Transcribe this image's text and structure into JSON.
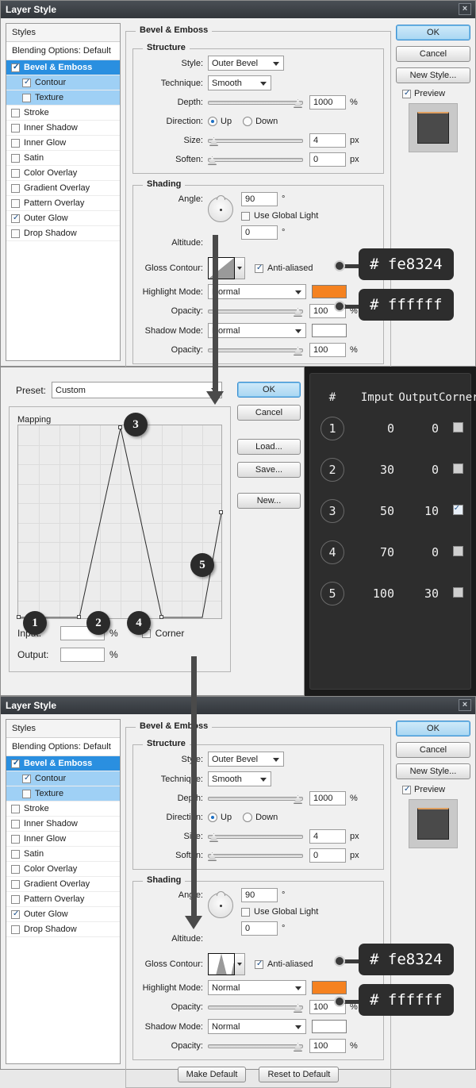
{
  "dialog": {
    "title": "Layer Style",
    "close_label": "×",
    "sidebar": {
      "header": "Styles",
      "blending": "Blending Options: Default",
      "items": [
        {
          "label": "Bevel & Emboss",
          "checked": true,
          "selected": true
        },
        {
          "label": "Contour",
          "checked": true,
          "child": true
        },
        {
          "label": "Texture",
          "checked": false,
          "child": true
        },
        {
          "label": "Stroke",
          "checked": false
        },
        {
          "label": "Inner Shadow",
          "checked": false
        },
        {
          "label": "Inner Glow",
          "checked": false
        },
        {
          "label": "Satin",
          "checked": false
        },
        {
          "label": "Color Overlay",
          "checked": false
        },
        {
          "label": "Gradient Overlay",
          "checked": false
        },
        {
          "label": "Pattern Overlay",
          "checked": false
        },
        {
          "label": "Outer Glow",
          "checked": true
        },
        {
          "label": "Drop Shadow",
          "checked": false
        }
      ]
    },
    "group_title": "Bevel & Emboss",
    "structure": {
      "title": "Structure",
      "style_label": "Style:",
      "style_value": "Outer Bevel",
      "technique_label": "Technique:",
      "technique_value": "Smooth",
      "depth_label": "Depth:",
      "depth_value": "1000",
      "depth_unit": "%",
      "direction_label": "Direction:",
      "direction_up": "Up",
      "direction_down": "Down",
      "size_label": "Size:",
      "size_value": "4",
      "size_unit": "px",
      "soften_label": "Soften:",
      "soften_value": "0",
      "soften_unit": "px"
    },
    "shading": {
      "title": "Shading",
      "angle_label": "Angle:",
      "angle_value": "90",
      "degree": "°",
      "global_light_label": "Use Global Light",
      "altitude_label": "Altitude:",
      "altitude_value": "0",
      "gloss_label": "Gloss Contour:",
      "antialiased_label": "Anti-aliased",
      "highlight_label": "Highlight Mode:",
      "highlight_mode": "Normal",
      "highlight_opacity_label": "Opacity:",
      "highlight_opacity": "100",
      "shadow_label": "Shadow Mode:",
      "shadow_mode": "Normal",
      "shadow_opacity_label": "Opacity:",
      "shadow_opacity": "100",
      "percent": "%"
    },
    "make_default": "Make Default",
    "reset_default": "Reset to Default",
    "right": {
      "ok": "OK",
      "cancel": "Cancel",
      "new_style": "New Style...",
      "preview": "Preview"
    },
    "hex_highlight": "# fe8324",
    "hex_shadow": "# ffffff",
    "swatch_highlight_color": "#f58220",
    "swatch_shadow_color": "#ffffff"
  },
  "editor": {
    "preset_label": "Preset:",
    "preset_value": "Custom",
    "mapping_title": "Mapping",
    "input_label": "Input:",
    "input_value": "",
    "output_label": "Output:",
    "output_value": "",
    "percent": "%",
    "corner_label": "Corner",
    "buttons": {
      "ok": "OK",
      "cancel": "Cancel",
      "load": "Load...",
      "save": "Save...",
      "new": "New..."
    },
    "markers": [
      "1",
      "2",
      "3",
      "4",
      "5"
    ]
  },
  "chart_data": {
    "type": "line",
    "title": "Mapping",
    "xlabel": "Input",
    "ylabel": "Output",
    "xlim": [
      0,
      100
    ],
    "ylim": [
      0,
      100
    ],
    "grid": true,
    "x": [
      0,
      30,
      50,
      70,
      100
    ],
    "values": [
      0,
      0,
      100,
      0,
      30
    ],
    "point_labels": [
      "1",
      "2",
      "3",
      "4",
      "5"
    ]
  },
  "table": {
    "headers": [
      "#",
      "Imput",
      "Output",
      "Corner"
    ],
    "rows": [
      {
        "n": "1",
        "input": "0",
        "output": "0",
        "corner": false
      },
      {
        "n": "2",
        "input": "30",
        "output": "0",
        "corner": false
      },
      {
        "n": "3",
        "input": "50",
        "output": "10",
        "corner": true
      },
      {
        "n": "4",
        "input": "70",
        "output": "0",
        "corner": false
      },
      {
        "n": "5",
        "input": "100",
        "output": "30",
        "corner": false
      }
    ]
  }
}
